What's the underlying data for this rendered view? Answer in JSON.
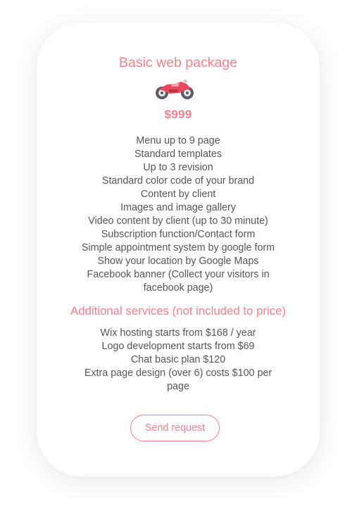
{
  "package": {
    "title": "Basic web package",
    "icon": "motorcycle-icon",
    "price": "$999",
    "features": [
      "Menu up to 9 page",
      "Standard templates",
      "Up to 3 revision",
      "Standard color code of your brand",
      "Content by client",
      "Images and image gallery",
      "Video content by client (up to 30 minute)",
      "Subscription function/Contact form",
      "Simple appointment system by google form",
      "Show your location by Google Maps",
      "Facebook banner (Collect your visitors in facebook page)"
    ]
  },
  "additional": {
    "title": "Additional services (not included to price)",
    "items": [
      "Wix hosting starts from  $168 / year",
      "Logo development starts from $69",
      "Chat basic plan $120",
      "Extra page design (over 6) costs $100 per page"
    ]
  },
  "cta": {
    "label": "Send request"
  },
  "colors": {
    "accent": "#f97f8c",
    "text": "#555555",
    "background": "#ffffff"
  }
}
